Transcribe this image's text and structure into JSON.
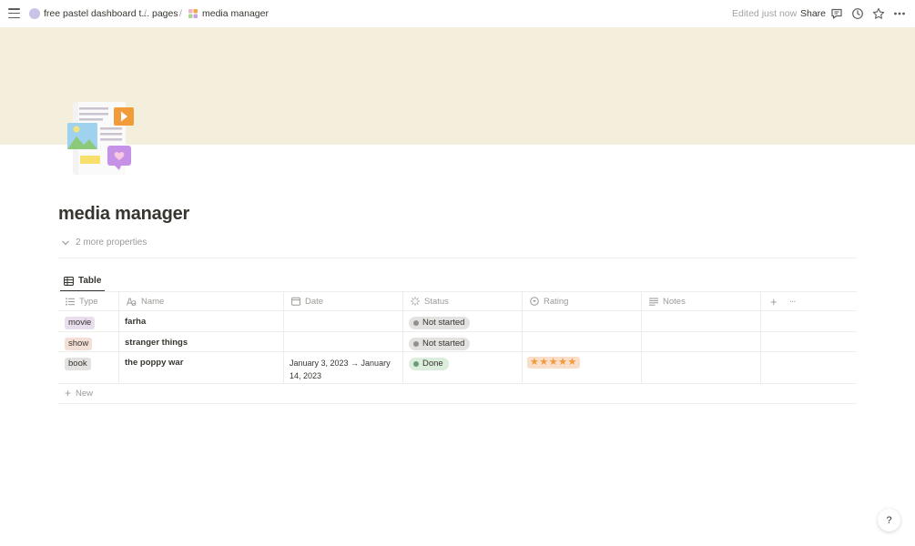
{
  "topbar": {
    "workspace_crumb": "free pastel dashboard t...",
    "pages_crumb": "pages",
    "current_crumb": "media manager",
    "separator": "/",
    "edited_status": "Edited just now",
    "share_label": "Share"
  },
  "page": {
    "title": "media manager",
    "more_properties": "2 more properties",
    "cover_color": "#f3efdc"
  },
  "view": {
    "tab_label": "Table"
  },
  "table": {
    "columns": {
      "type": "Type",
      "name": "Name",
      "date": "Date",
      "status": "Status",
      "rating": "Rating",
      "notes": "Notes",
      "add": "+",
      "more": "···"
    },
    "rows": [
      {
        "type": "movie",
        "type_color": "#e8deee",
        "name": "farha",
        "date": "",
        "status": "Not started",
        "status_color": "#e3e2e0",
        "status_dot": "#91918e",
        "rating": "",
        "notes": ""
      },
      {
        "type": "show",
        "type_color": "#f4dfd7",
        "name": "stranger things",
        "date": "",
        "status": "Not started",
        "status_color": "#e3e2e0",
        "status_dot": "#91918e",
        "rating": "",
        "notes": ""
      },
      {
        "type": "book",
        "type_color": "#e3e2e0",
        "name": "the poppy war",
        "date": "January 3, 2023 → January 14, 2023",
        "status": "Done",
        "status_color": "#dbeddb",
        "status_dot": "#6c9b7d",
        "rating": "★★★★★",
        "notes": ""
      }
    ],
    "new_label": "New"
  },
  "help": {
    "label": "?"
  }
}
